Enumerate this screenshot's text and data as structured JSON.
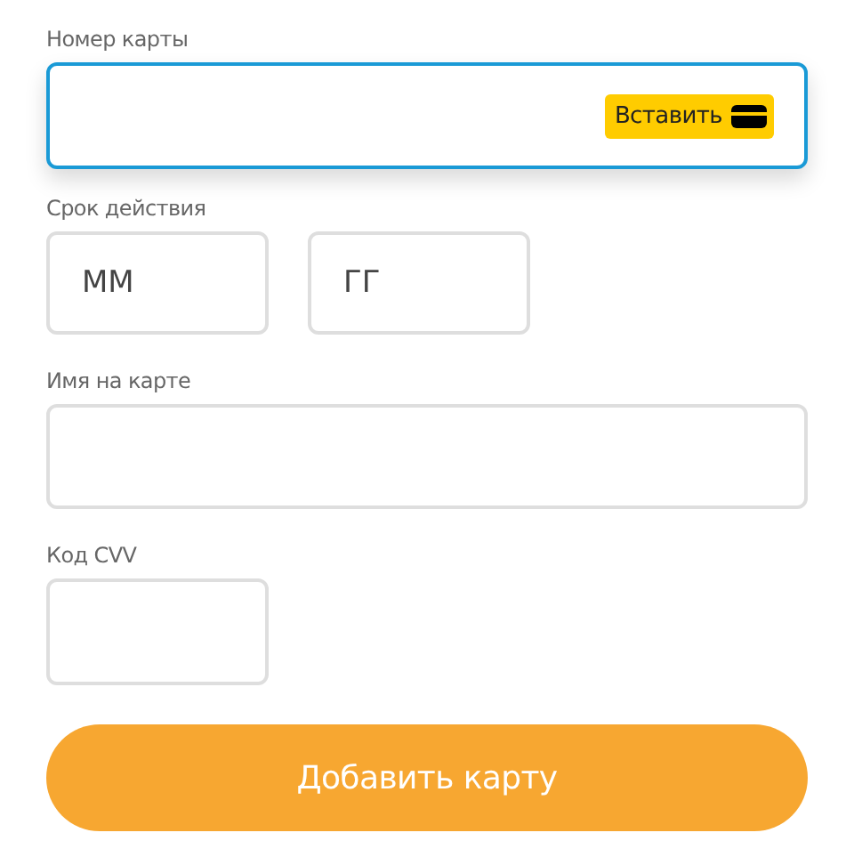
{
  "card_number": {
    "label": "Номер карты",
    "focused": true,
    "paste_button": "Вставить"
  },
  "expiry": {
    "label": "Срок действия",
    "month": {
      "placeholder": "ММ",
      "focused": false
    },
    "year": {
      "placeholder": "ГГ",
      "focused": false
    }
  },
  "name_on_card": {
    "label": "Имя на карте",
    "focused": false
  },
  "cvv": {
    "label": "Код CVV",
    "focused": false
  },
  "submit_button": "Добавить карту"
}
